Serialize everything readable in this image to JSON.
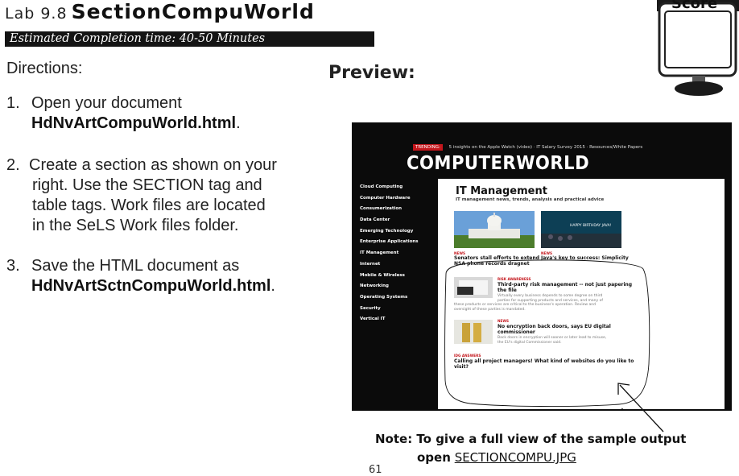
{
  "header": {
    "lab": "Lab 9.8",
    "name": "SectionCompuWorld",
    "estimate": "Estimated Completion time: 40-50 Minutes"
  },
  "directions": {
    "heading": "Directions:",
    "steps": [
      {
        "num": "1.",
        "line1": "Open your document",
        "file": "HdNvArtCompuWorld.html",
        "tail": "."
      },
      {
        "num": "2.",
        "line1": "Create a section as shown on your",
        "line2": "right. Use the SECTION tag and",
        "line3": "table tags.  Work files are located",
        "line4": "in the SeLS Work files folder."
      },
      {
        "num": "3.",
        "line1": "Save the HTML document as",
        "file": "HdNvArtSctnCompuWorld.html",
        "tail": "."
      }
    ]
  },
  "preview_label": "Preview:",
  "score_label": "Score",
  "preview": {
    "trending_pill": "TRENDING:",
    "trending_text": "5 insights on the Apple Watch (video)  ·  IT Salary Survey 2015  ·  Resources/White Papers",
    "logo": "COMPUTERWORLD",
    "nav": [
      "Cloud Computing",
      "Computer Hardware",
      "Consumerization",
      "Data Center",
      "Emerging Technology",
      "Enterprise Applications",
      "IT Management",
      "Internet",
      "Mobile & Wireless",
      "Networking",
      "Operating Systems",
      "Security",
      "Vertical IT"
    ],
    "section_title": "IT Management",
    "section_sub": "IT management news, trends, analysis and practical advice",
    "banner_text": "HAPPY BIRTHDAY JAVA!",
    "story1": {
      "tag": "NEWS",
      "headline1": "Senators stall efforts to extend",
      "headline2": "NSA phone records dragnet"
    },
    "story2": {
      "tag": "NEWS",
      "headline": "Java's key to success: Simplicity"
    },
    "story3": {
      "tag": "RISK AWARENESS",
      "headline1": "Third-party risk management -- not just papering",
      "headline2": "the file",
      "body1": "Virtually every business depends to some degree on third",
      "body2": "parties for supporting products and services, and many of",
      "body3": "these products or services are critical to the business's operation. Review and",
      "body4": "oversight of these parties is mandated."
    },
    "story4": {
      "tag": "NEWS",
      "headline1": "No encryption back doors, says EU digital",
      "headline2": "commissioner",
      "body1": "Back doors in encryption will sooner or later lead to misuse,",
      "body2": "the EU's digital Commissioner said."
    },
    "story5": {
      "tag": "IDG ANSWERS",
      "headline1": "Calling all project managers! What kind of websites do you like to",
      "headline2": "visit?"
    }
  },
  "note": {
    "line1": "Note: To give a full view of the sample output",
    "open_word": "open",
    "file": "SECTIONCOMPU.JPG"
  },
  "page_number": "61"
}
